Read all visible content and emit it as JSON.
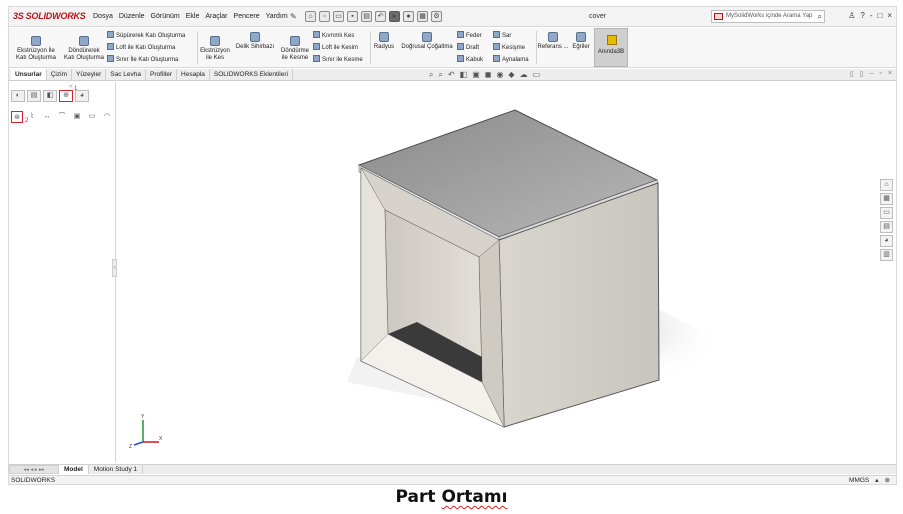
{
  "titlebar": {
    "logo": "SOLIDWORKS",
    "menu": [
      "Dosya",
      "Düzenle",
      "Görünüm",
      "Ekle",
      "Araçlar",
      "Pencere",
      "Yardım"
    ],
    "doc_title": "cover",
    "search_placeholder": "MySolidWorks içinde Arama Yap",
    "window_controls": [
      "?",
      "-",
      "□",
      "×"
    ]
  },
  "ribbon": {
    "extrude": [
      "Ekstrüzyon İle",
      "Katı Oluşturma"
    ],
    "revolve": [
      "Döndürerek",
      "Katı Oluşturma"
    ],
    "sweep_loft": [
      "Süpürerek Katı Oluşturma",
      "Loft ile Katı Oluşturma",
      "Sınır İle Katı Oluşturma"
    ],
    "extrude_cut": [
      "Ekstrüzyon",
      "ile Kes"
    ],
    "hole_wizard": "Delik Sihirbazı",
    "revolve_cut": [
      "Döndürme",
      "ile Kesme"
    ],
    "cut_group": [
      "Kıvrımlı Kes",
      "Loft ile Kesim",
      "Sınır ile Kesme"
    ],
    "fillet": "Radyus",
    "linear_pattern": "Doğrusal Çoğaltma",
    "rib_group": [
      "Feder",
      "Draft",
      "Kabuk"
    ],
    "wrap_group": [
      "Sar",
      "Kesişme",
      "Aynalama"
    ],
    "reference": "Referans ...",
    "curves": "Eğriler",
    "instant3d": "Anında3B"
  },
  "tabs": [
    "Unsurlar",
    "Çizim",
    "Yüzeyler",
    "Sac Levha",
    "Profiller",
    "Hesapla",
    "SOLIDWORKS Eklentileri"
  ],
  "active_tab": "Unsurlar",
  "markers": [
    "1",
    "2"
  ],
  "bottom_tabs": [
    "Model",
    "Motion Study 1"
  ],
  "status": {
    "left": "SOLIDWORKS",
    "units": "MMGS"
  },
  "triad": {
    "x": "X",
    "y": "Y",
    "z": "Z"
  },
  "caption": {
    "part1": "Part",
    "part2": "Ortamı"
  },
  "colors": {
    "highlight": "#d6212b",
    "brand": "#c0121b"
  }
}
